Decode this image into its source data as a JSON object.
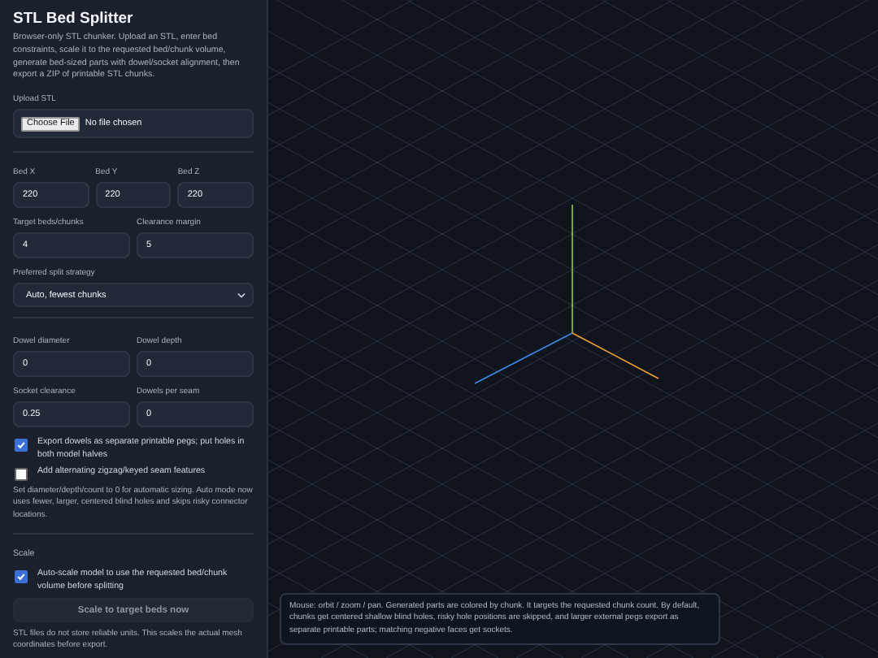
{
  "sidebar": {
    "title": "STL Bed Splitter",
    "description": "Browser-only STL chunker. Upload an STL, enter bed constraints, scale it to the requested bed/chunk volume, generate bed-sized parts with dowel/socket alignment, then export a ZIP of printable STL chunks.",
    "upload": {
      "label": "Upload STL",
      "button": "Choose File",
      "status": "No file chosen"
    },
    "bed_fields": [
      {
        "label": "Bed X",
        "value": "220"
      },
      {
        "label": "Bed Y",
        "value": "220"
      },
      {
        "label": "Bed Z",
        "value": "220"
      }
    ],
    "target_fields": [
      {
        "label": "Target beds/chunks",
        "value": "4"
      },
      {
        "label": "Clearance margin",
        "value": "5"
      }
    ],
    "strategy": {
      "label": "Preferred split strategy",
      "value": "Auto, fewest chunks"
    },
    "dowel_fields": [
      {
        "label": "Dowel diameter",
        "value": "0"
      },
      {
        "label": "Dowel depth",
        "value": "0"
      },
      {
        "label": "Socket clearance",
        "value": "0.25"
      },
      {
        "label": "Dowels per seam",
        "value": "0"
      }
    ],
    "options": [
      {
        "label": "Export dowels as separate printable pegs; put holes in both model halves",
        "checked": true
      },
      {
        "label": "Add alternating zigzag/keyed seam features",
        "checked": false
      }
    ],
    "hint": "Set diameter/depth/count to 0 for automatic sizing. Auto mode now uses fewer, larger, centered blind holes and skips risky connector locations.",
    "scale": {
      "heading": "Scale",
      "option": {
        "label": "Auto-scale model to use the requested bed/chunk volume before splitting",
        "checked": true
      },
      "button": "Scale to target beds now",
      "note": "STL files do not store reliable units. This scales the actual mesh coordinates before export."
    }
  },
  "viewport": {
    "info": "Mouse: orbit / zoom / pan. Generated parts are colored by chunk. It targets the requested chunk count. By default, chunks get centered shallow blind holes, risky hole positions are skipped, and larger external pegs export as separate printable parts; matching negative faces get sockets."
  }
}
